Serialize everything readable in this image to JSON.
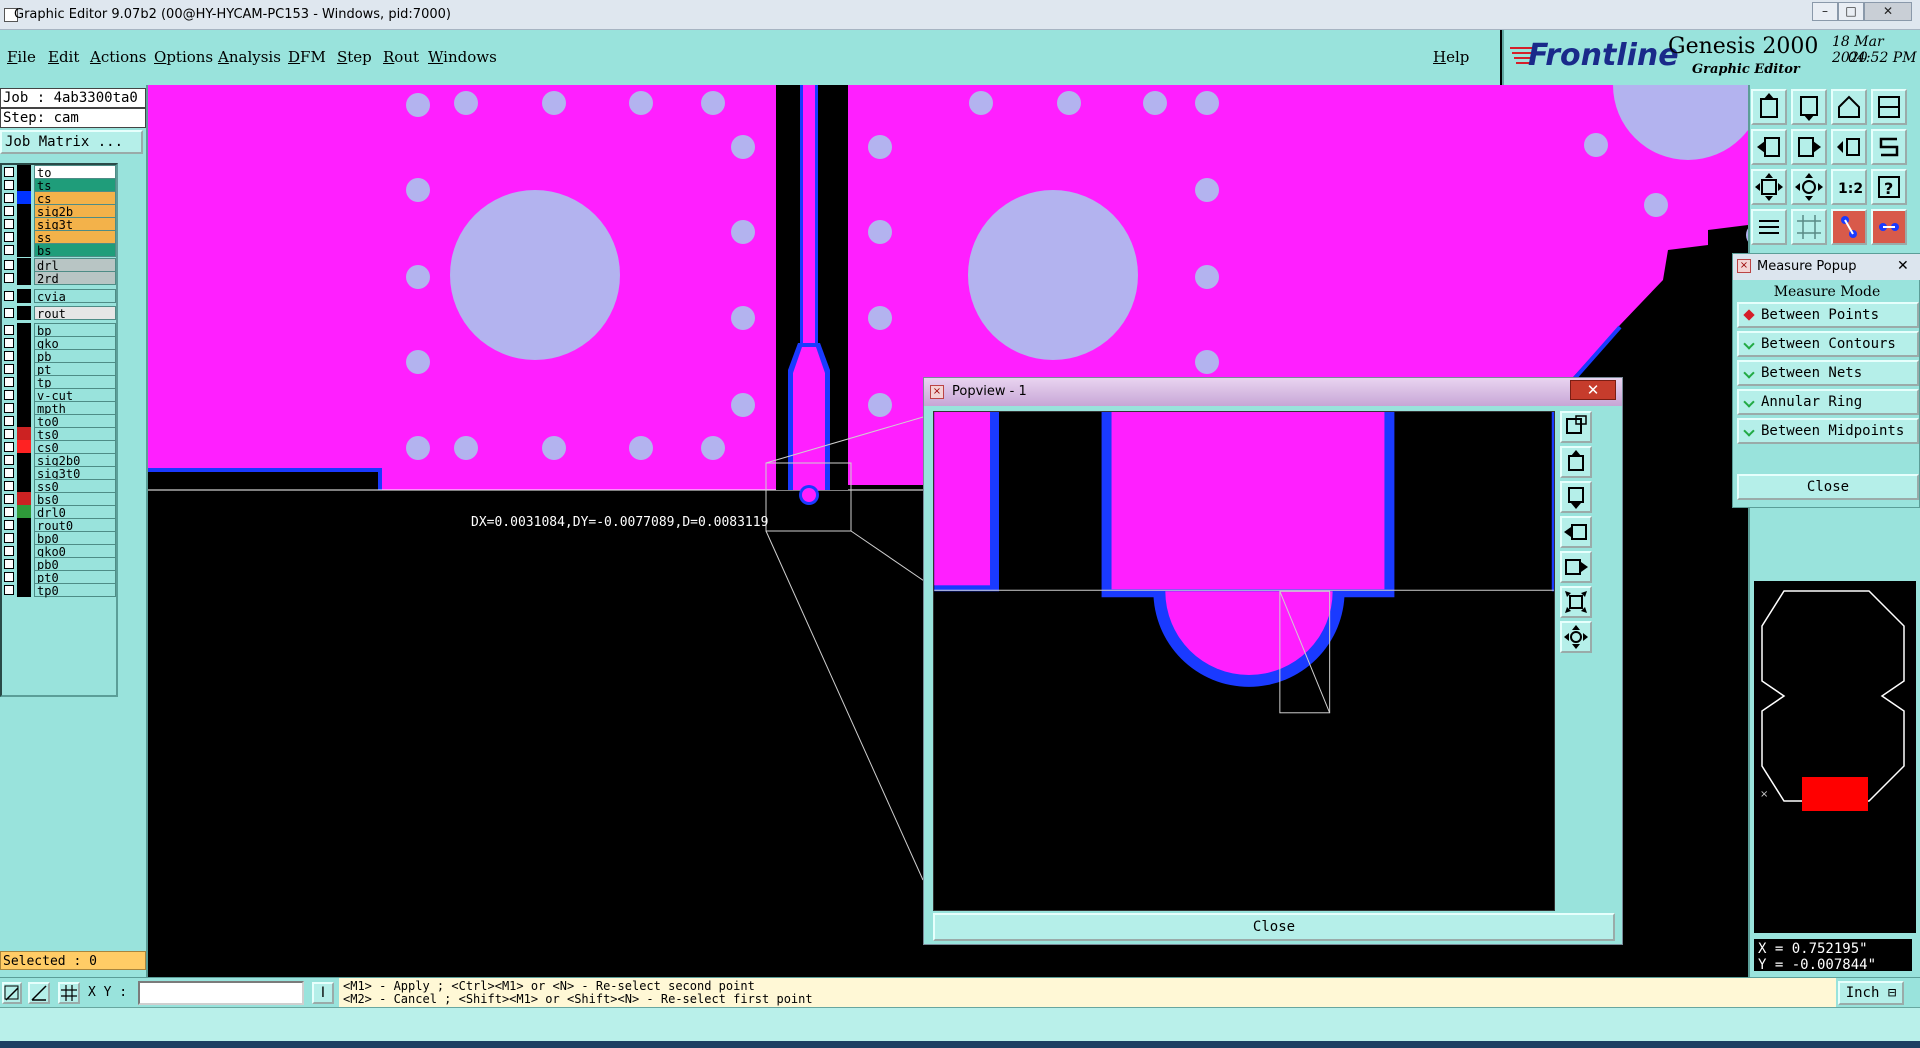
{
  "window": {
    "title": "Graphic Editor 9.07b2 (00@HY-HYCAM-PC153 - Windows, pid:7000)"
  },
  "menu": {
    "items": [
      "File",
      "Edit",
      "Actions",
      "Options",
      "Analysis",
      "DFM",
      "Step",
      "Rout",
      "Windows"
    ],
    "help": "Help"
  },
  "brand": {
    "logo": "Frontline",
    "product": "Genesis 2000",
    "subtitle": "Graphic Editor",
    "date": "18 Mar 2020",
    "time": "04:52 PM"
  },
  "job": {
    "job_line": "Job : 4ab3300ta0",
    "step_line": "Step: cam",
    "matrix_button": "Job Matrix ..."
  },
  "layers": [
    {
      "name": "to",
      "color": "#ffffff",
      "swatch": "#000000"
    },
    {
      "name": "ts",
      "color": "#1f9d7a",
      "swatch": "#000000"
    },
    {
      "name": "cs",
      "color": "#f3b24a",
      "swatch": "#0033ff"
    },
    {
      "name": "sig2b",
      "color": "#f3b24a",
      "swatch": "#000000"
    },
    {
      "name": "sig3t",
      "color": "#f3b24a",
      "swatch": "#000000"
    },
    {
      "name": "ss",
      "color": "#f3b24a",
      "swatch": "#000000"
    },
    {
      "name": "bs",
      "color": "#1f9d7a",
      "swatch": "#000000"
    },
    {
      "name": "drl",
      "color": "#b8c5c4",
      "swatch": "#000000"
    },
    {
      "name": "2rd",
      "color": "#b8c5c4",
      "swatch": "#000000"
    },
    {
      "name": "cvia",
      "color": "#99e3dc",
      "swatch": "#000000"
    },
    {
      "name": "rout",
      "color": "#e6e6e6",
      "swatch": "#000000"
    },
    {
      "name": "bp",
      "color": "#99e3dc",
      "swatch": "#000000"
    },
    {
      "name": "gko",
      "color": "#99e3dc",
      "swatch": "#000000"
    },
    {
      "name": "pb",
      "color": "#99e3dc",
      "swatch": "#000000"
    },
    {
      "name": "pt",
      "color": "#99e3dc",
      "swatch": "#000000"
    },
    {
      "name": "tp",
      "color": "#99e3dc",
      "swatch": "#000000"
    },
    {
      "name": "v-cut",
      "color": "#99e3dc",
      "swatch": "#000000"
    },
    {
      "name": "mpth",
      "color": "#99e3dc",
      "swatch": "#000000"
    },
    {
      "name": "to0",
      "color": "#99e3dc",
      "swatch": "#000000"
    },
    {
      "name": "ts0",
      "color": "#99e3dc",
      "swatch": "#cc2222"
    },
    {
      "name": "cs0",
      "color": "#99e3dc",
      "swatch": "#ff2222"
    },
    {
      "name": "sig2b0",
      "color": "#99e3dc",
      "swatch": "#000000"
    },
    {
      "name": "sig3t0",
      "color": "#99e3dc",
      "swatch": "#000000"
    },
    {
      "name": "ss0",
      "color": "#99e3dc",
      "swatch": "#000000"
    },
    {
      "name": "bs0",
      "color": "#99e3dc",
      "swatch": "#cc2222"
    },
    {
      "name": "drl0",
      "color": "#99e3dc",
      "swatch": "#2f9a3a"
    },
    {
      "name": "rout0",
      "color": "#99e3dc",
      "swatch": "#000000"
    },
    {
      "name": "bp0",
      "color": "#99e3dc",
      "swatch": "#000000"
    },
    {
      "name": "gko0",
      "color": "#99e3dc",
      "swatch": "#000000"
    },
    {
      "name": "pb0",
      "color": "#99e3dc",
      "swatch": "#000000"
    },
    {
      "name": "pt0",
      "color": "#99e3dc",
      "swatch": "#000000"
    },
    {
      "name": "tp0",
      "color": "#99e3dc",
      "swatch": "#000000"
    }
  ],
  "selected_label": "Selected : 0",
  "measure_readout": "DX=0.0031084,DY=-0.0077089,D=0.0083119",
  "measure_popup": {
    "title": "Measure Popup",
    "mode_label": "Measure Mode",
    "options": [
      "Between Points",
      "Between Contours",
      "Between Nets",
      "Annular Ring",
      "Between Midpoints"
    ],
    "selected": "Between Points",
    "close": "Close"
  },
  "popview": {
    "title": "Popview - 1",
    "close": "Close",
    "close_x": "✕"
  },
  "coordinates": {
    "x": "X = 0.752195\"",
    "y": "Y = -0.007844\""
  },
  "bottom": {
    "xy_label": "X Y :",
    "xy_value": "",
    "hint_line1": "<M1> - Apply  ; <Ctrl><M1> or <N> - Re-select second point",
    "hint_line2": "<M2> - Cancel ; <Shift><M1> or <Shift><N> - Re-select first point",
    "unit": "Inch"
  },
  "colors": {
    "panel": "#99e3dc",
    "copper": "#ff1fff",
    "hole": "#b3b3ef",
    "soldermask": "#0022ff",
    "accent": "#d51f2a"
  }
}
